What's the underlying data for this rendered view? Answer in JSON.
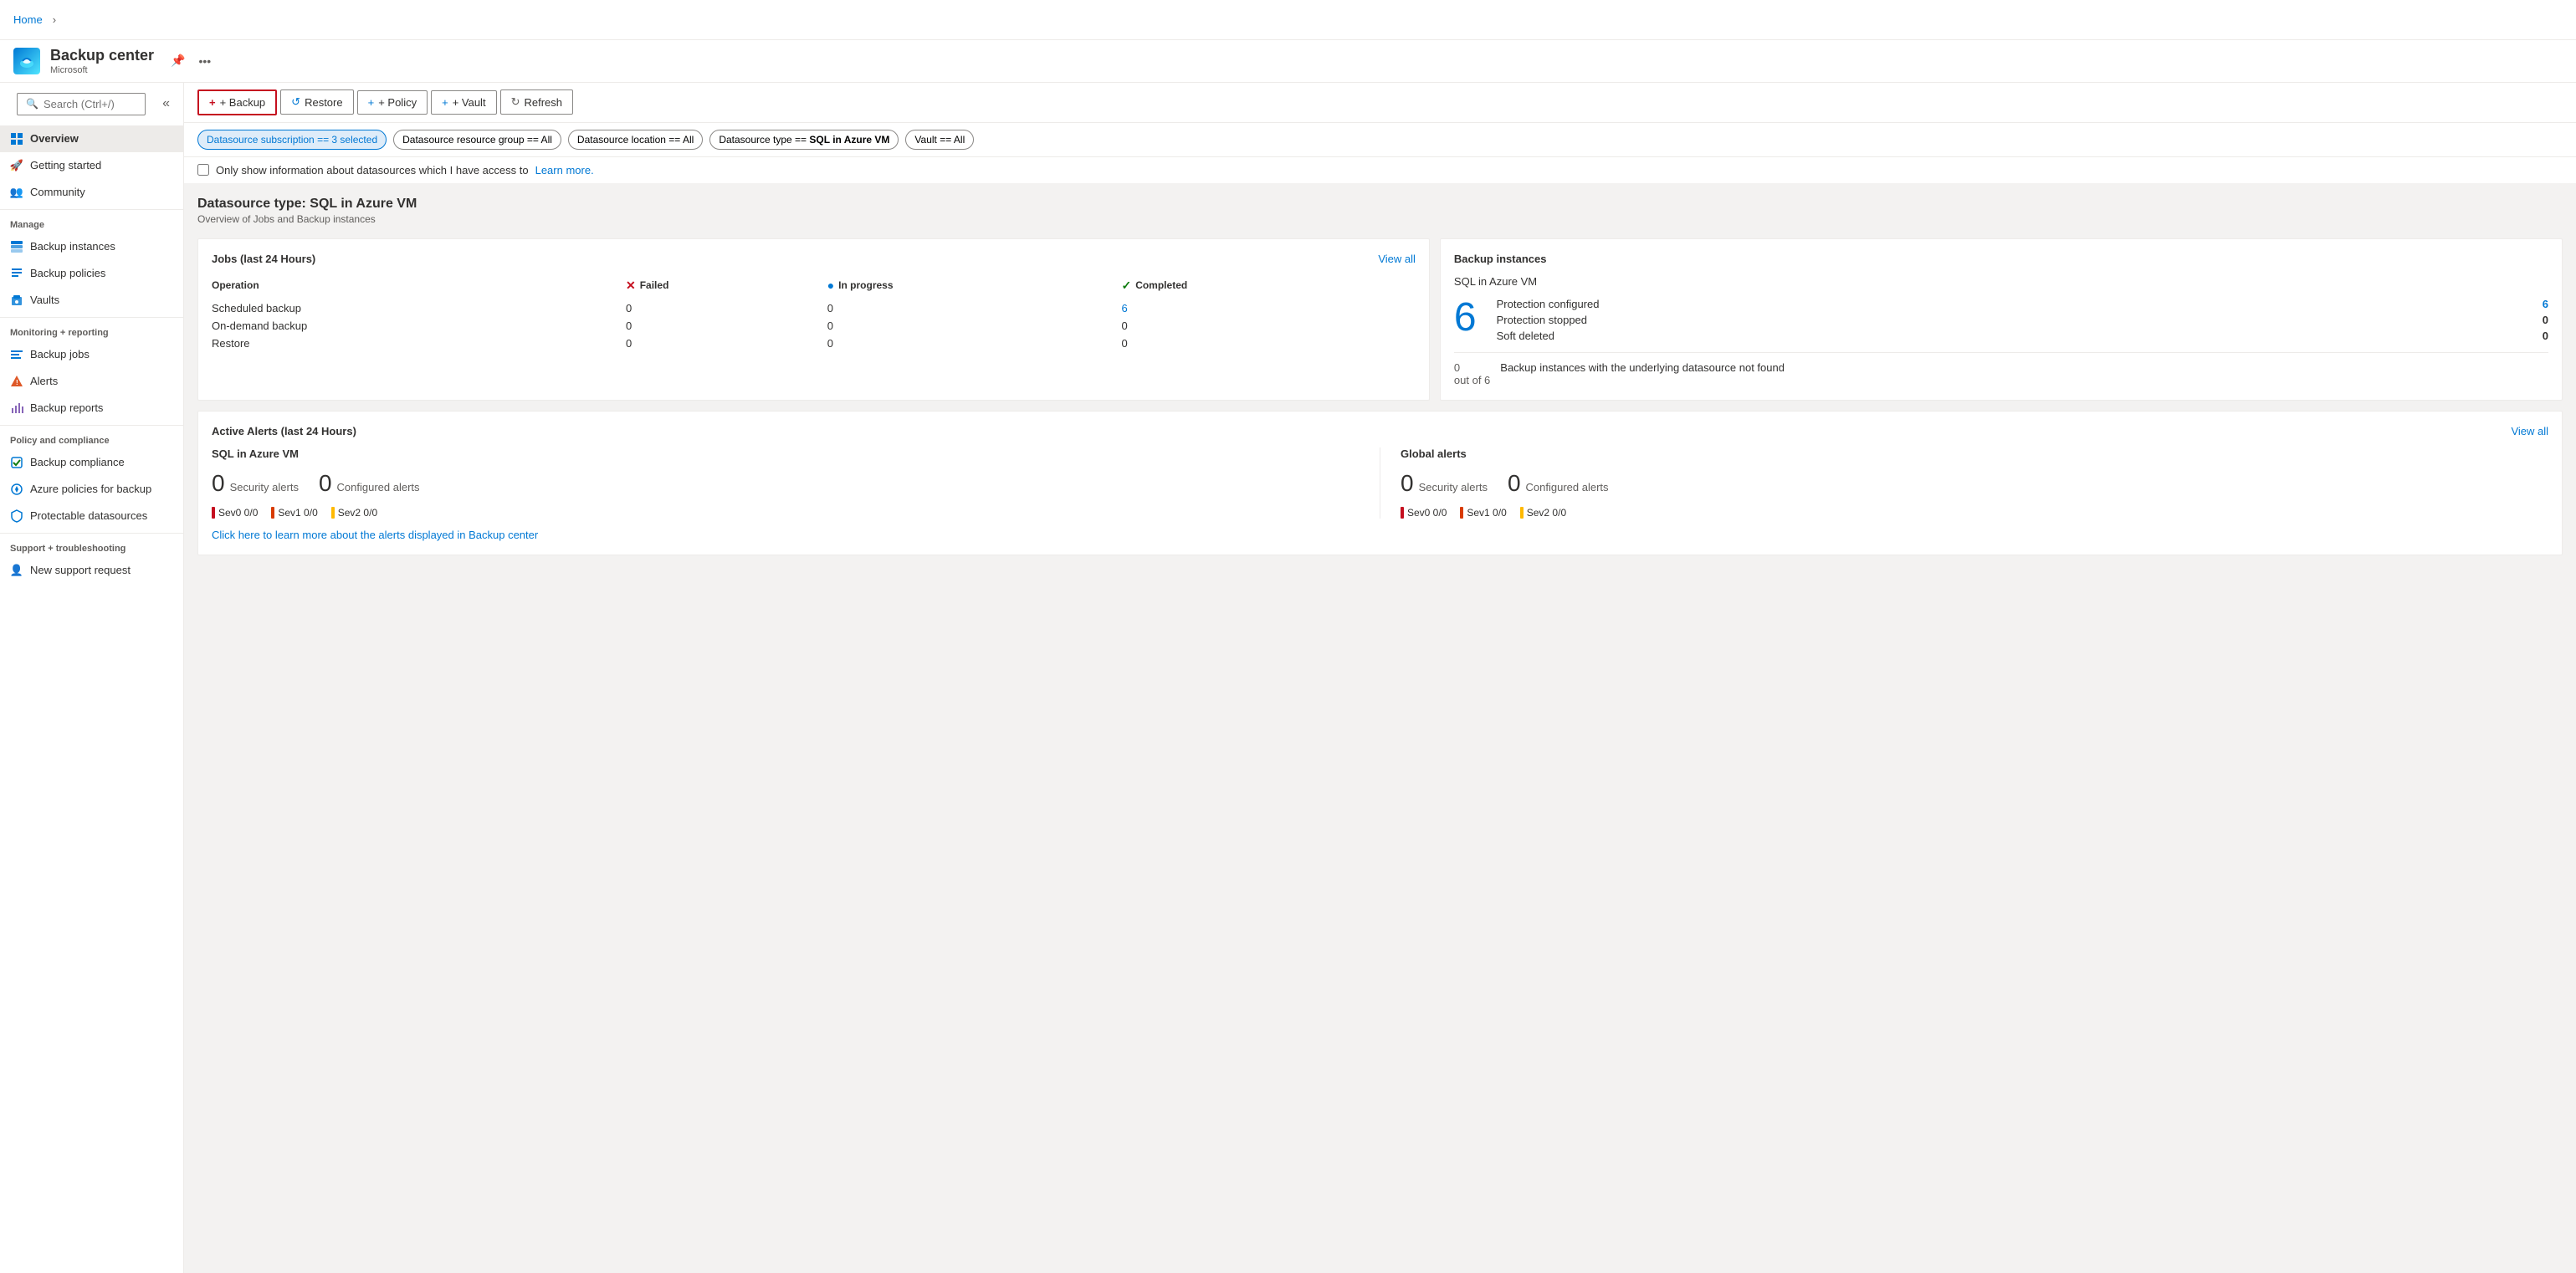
{
  "breadcrumb": {
    "home": "Home",
    "separator": "›"
  },
  "app": {
    "title": "Backup center",
    "subtitle": "Microsoft",
    "pin_tooltip": "Pin",
    "more_tooltip": "More options"
  },
  "toolbar": {
    "backup_label": "+ Backup",
    "restore_label": "Restore",
    "policy_label": "+ Policy",
    "vault_label": "+ Vault",
    "refresh_label": "Refresh"
  },
  "filters": [
    {
      "id": "subscription",
      "label": "Datasource subscription == 3 selected",
      "active": true
    },
    {
      "id": "resource_group",
      "label": "Datasource resource group == All",
      "active": false
    },
    {
      "id": "location",
      "label": "Datasource location == All",
      "active": false
    },
    {
      "id": "type",
      "label": "Datasource type == SQL in Azure VM",
      "active": false
    },
    {
      "id": "vault",
      "label": "Vault == All",
      "active": false
    }
  ],
  "checkbox": {
    "label": "Only show information about datasources which I have access to",
    "link_text": "Learn more."
  },
  "datasource": {
    "heading": "Datasource type: SQL in Azure VM",
    "subheading": "Overview of Jobs and Backup instances"
  },
  "jobs_card": {
    "title": "Jobs (last 24 Hours)",
    "view_all": "View all",
    "columns": {
      "operation": "Operation",
      "failed": "Failed",
      "inprogress": "In progress",
      "completed": "Completed"
    },
    "rows": [
      {
        "operation": "Scheduled backup",
        "failed": "0",
        "inprogress": "0",
        "completed": "6"
      },
      {
        "operation": "On-demand backup",
        "failed": "0",
        "inprogress": "0",
        "completed": "0"
      },
      {
        "operation": "Restore",
        "failed": "0",
        "inprogress": "0",
        "completed": "0"
      }
    ],
    "completed_link_row": 0
  },
  "backup_instances_card": {
    "title": "Backup instances",
    "type_label": "SQL in Azure VM",
    "total_count": "6",
    "protection_configured_label": "Protection configured",
    "protection_configured_value": "6",
    "protection_stopped_label": "Protection stopped",
    "protection_stopped_value": "0",
    "soft_deleted_label": "Soft deleted",
    "soft_deleted_value": "0",
    "footer_count": "0",
    "footer_out_of": "out of 6",
    "footer_desc": "Backup instances with the underlying datasource not found"
  },
  "alerts_card": {
    "title": "Active Alerts (last 24 Hours)",
    "view_all": "View all",
    "sql_section": {
      "title": "SQL in Azure VM",
      "security_count": "0",
      "security_label": "Security alerts",
      "configured_count": "0",
      "configured_label": "Configured alerts",
      "sev_items": [
        {
          "label": "Sev0",
          "value": "0/0",
          "color": "red"
        },
        {
          "label": "Sev1",
          "value": "0/0",
          "color": "orange"
        },
        {
          "label": "Sev2",
          "value": "0/0",
          "color": "yellow"
        }
      ]
    },
    "global_section": {
      "title": "Global alerts",
      "security_count": "0",
      "security_label": "Security alerts",
      "configured_count": "0",
      "configured_label": "Configured alerts",
      "sev_items": [
        {
          "label": "Sev0",
          "value": "0/0",
          "color": "red"
        },
        {
          "label": "Sev1",
          "value": "0/0",
          "color": "orange"
        },
        {
          "label": "Sev2",
          "value": "0/0",
          "color": "yellow"
        }
      ]
    },
    "footer_link": "Click here to learn more about the alerts displayed in Backup center"
  },
  "sidebar": {
    "search_placeholder": "Search (Ctrl+/)",
    "items_top": [
      {
        "id": "overview",
        "label": "Overview",
        "icon": "grid-icon",
        "active": true
      },
      {
        "id": "getting-started",
        "label": "Getting started",
        "icon": "rocket-icon",
        "active": false
      },
      {
        "id": "community",
        "label": "Community",
        "icon": "people-icon",
        "active": false
      }
    ],
    "sections": [
      {
        "label": "Manage",
        "items": [
          {
            "id": "backup-instances",
            "label": "Backup instances",
            "icon": "instances-icon"
          },
          {
            "id": "backup-policies",
            "label": "Backup policies",
            "icon": "policies-icon"
          },
          {
            "id": "vaults",
            "label": "Vaults",
            "icon": "vaults-icon"
          }
        ]
      },
      {
        "label": "Monitoring + reporting",
        "items": [
          {
            "id": "backup-jobs",
            "label": "Backup jobs",
            "icon": "jobs-icon"
          },
          {
            "id": "alerts",
            "label": "Alerts",
            "icon": "alerts-icon"
          },
          {
            "id": "backup-reports",
            "label": "Backup reports",
            "icon": "reports-icon"
          }
        ]
      },
      {
        "label": "Policy and compliance",
        "items": [
          {
            "id": "backup-compliance",
            "label": "Backup compliance",
            "icon": "compliance-icon"
          },
          {
            "id": "azure-policies",
            "label": "Azure policies for backup",
            "icon": "azure-policy-icon"
          },
          {
            "id": "protectable-datasources",
            "label": "Protectable datasources",
            "icon": "protect-icon"
          }
        ]
      },
      {
        "label": "Support + troubleshooting",
        "items": [
          {
            "id": "new-support",
            "label": "New support request",
            "icon": "support-icon"
          }
        ]
      }
    ]
  }
}
